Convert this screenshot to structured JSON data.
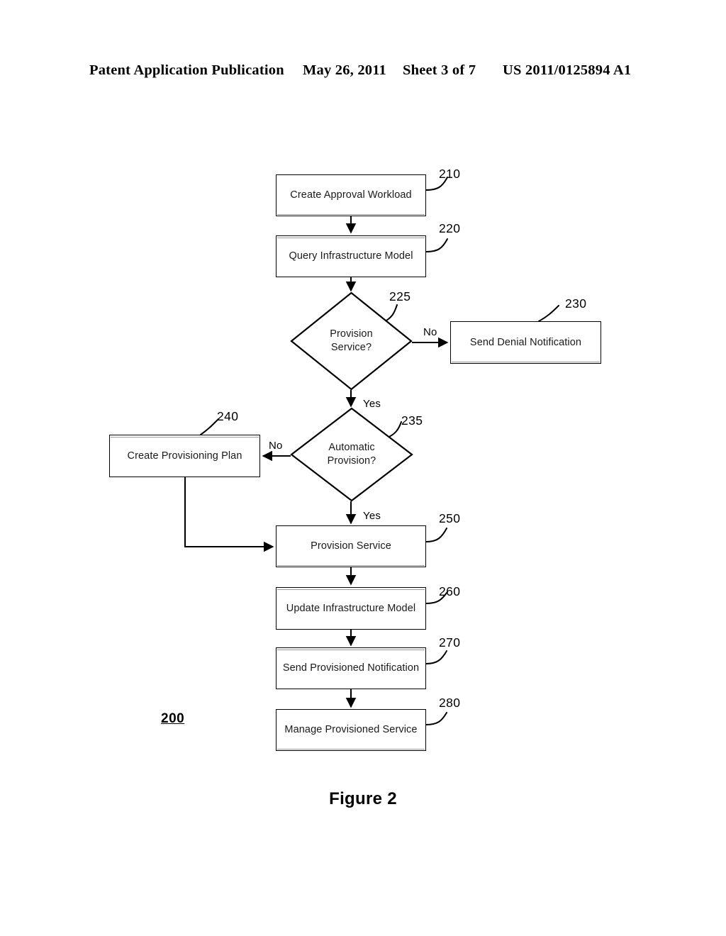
{
  "header": {
    "publication": "Patent Application Publication",
    "date": "May 26, 2011",
    "sheet": "Sheet 3 of 7",
    "pub_number": "US 2011/0125894 A1"
  },
  "figure": {
    "caption": "Figure 2",
    "flow_id": "200"
  },
  "flowchart": {
    "type": "flowchart",
    "nodes": [
      {
        "id": "210",
        "shape": "process",
        "label": "Create Approval Workload",
        "ref": "210"
      },
      {
        "id": "220",
        "shape": "process",
        "label": "Query Infrastructure Model",
        "ref": "220"
      },
      {
        "id": "225",
        "shape": "decision",
        "label_line1": "Provision",
        "label_line2": "Service?",
        "ref": "225"
      },
      {
        "id": "230",
        "shape": "process",
        "label": "Send Denial Notification",
        "ref": "230"
      },
      {
        "id": "235",
        "shape": "decision",
        "label_line1": "Automatic",
        "label_line2": "Provision?",
        "ref": "235"
      },
      {
        "id": "240",
        "shape": "process",
        "label": "Create Provisioning Plan",
        "ref": "240"
      },
      {
        "id": "250",
        "shape": "process",
        "label": "Provision Service",
        "ref": "250"
      },
      {
        "id": "260",
        "shape": "process",
        "label": "Update Infrastructure Model",
        "ref": "260"
      },
      {
        "id": "270",
        "shape": "process",
        "label": "Send Provisioned Notification",
        "ref": "270"
      },
      {
        "id": "280",
        "shape": "process",
        "label": "Manage Provisioned Service",
        "ref": "280"
      }
    ],
    "edges": [
      {
        "from": "210",
        "to": "220",
        "label": ""
      },
      {
        "from": "220",
        "to": "225",
        "label": ""
      },
      {
        "from": "225",
        "to": "230",
        "label": "No"
      },
      {
        "from": "225",
        "to": "235",
        "label": "Yes"
      },
      {
        "from": "235",
        "to": "240",
        "label": "No"
      },
      {
        "from": "235",
        "to": "250",
        "label": "Yes"
      },
      {
        "from": "240",
        "to": "250",
        "label": ""
      },
      {
        "from": "250",
        "to": "260",
        "label": ""
      },
      {
        "from": "260",
        "to": "270",
        "label": ""
      },
      {
        "from": "270",
        "to": "280",
        "label": ""
      }
    ],
    "branch_labels": {
      "no_225": "No",
      "yes_225": "Yes",
      "no_235": "No",
      "yes_235": "Yes"
    }
  },
  "colors": {
    "ink": "#000000",
    "paper": "#ffffff",
    "text": "#1a1a1a"
  }
}
